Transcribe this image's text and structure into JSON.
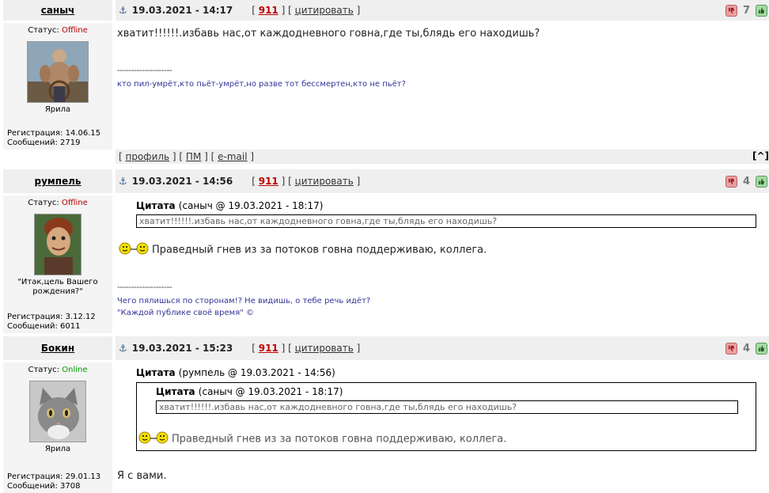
{
  "posts": [
    {
      "username": "саныч",
      "status_label": "Статус: ",
      "status": "Offline",
      "user_title": "Ярила",
      "reg": "Регистрация: 14.06.15",
      "msgs": "Сообщений: 2719",
      "date": "19.03.2021 - 14:17",
      "link_num": "911",
      "quote_link": "цитировать",
      "rating": "7",
      "message": "хватит!!!!!!.избавь нас,от каждодневного говна,где ты,блядь его находишь?",
      "sig_sep": "--------------------",
      "sig1": "кто пил-умрёт,кто пьёт-умрёт,но разве тот бессмертен,кто не пьёт?",
      "footer": {
        "profile": "профиль",
        "pm": "ПМ",
        "email": "e-mail",
        "top": "[^]"
      }
    },
    {
      "username": "румпель",
      "status_label": "Статус: ",
      "status": "Offline",
      "user_title": "\"Итак,цель Вашего рождения?\"",
      "reg": "Регистрация: 3.12.12",
      "msgs": "Сообщений: 6011",
      "date": "19.03.2021 - 14:56",
      "link_num": "911",
      "quote_link": "цитировать",
      "rating": "4",
      "quote_label": "Цитата",
      "quote_meta": "(саныч @ 19.03.2021 - 18:17)",
      "quote_text": "хватит!!!!!!.избавь нас,от каждодневного говна,где ты,блядь его находишь?",
      "message": "Праведный гнев из за потоков говна поддерживаю, коллега.",
      "sig_sep": "--------------------",
      "sig1": "Чего пялишься по сторонам!? Не видишь, о тебе речь идёт?",
      "sig2": "\"Каждой публике своё время\" ©"
    },
    {
      "username": "Бокин",
      "status_label": "Статус: ",
      "status": "Online",
      "user_title": "Ярила",
      "reg": "Регистрация: 29.01.13",
      "msgs": "Сообщений: 3708",
      "date": "19.03.2021 - 15:23",
      "link_num": "911",
      "quote_link": "цитировать",
      "rating": "4",
      "quote_label": "Цитата",
      "quote_meta": "(румпель @ 19.03.2021 - 14:56)",
      "inner_quote_label": "Цитата",
      "inner_quote_meta": "(саныч @ 19.03.2021 - 18:17)",
      "inner_quote_text": "хватит!!!!!!.избавь нас,от каждодневного говна,где ты,блядь его находишь?",
      "inner_message": "Праведный гнев из за потоков говна поддерживаю, коллега.",
      "message": "Я с вами."
    }
  ],
  "icons": {
    "anchor": "⚓",
    "thumb_down": "thumb-down-icon",
    "thumb_up": "thumb-up-icon"
  }
}
